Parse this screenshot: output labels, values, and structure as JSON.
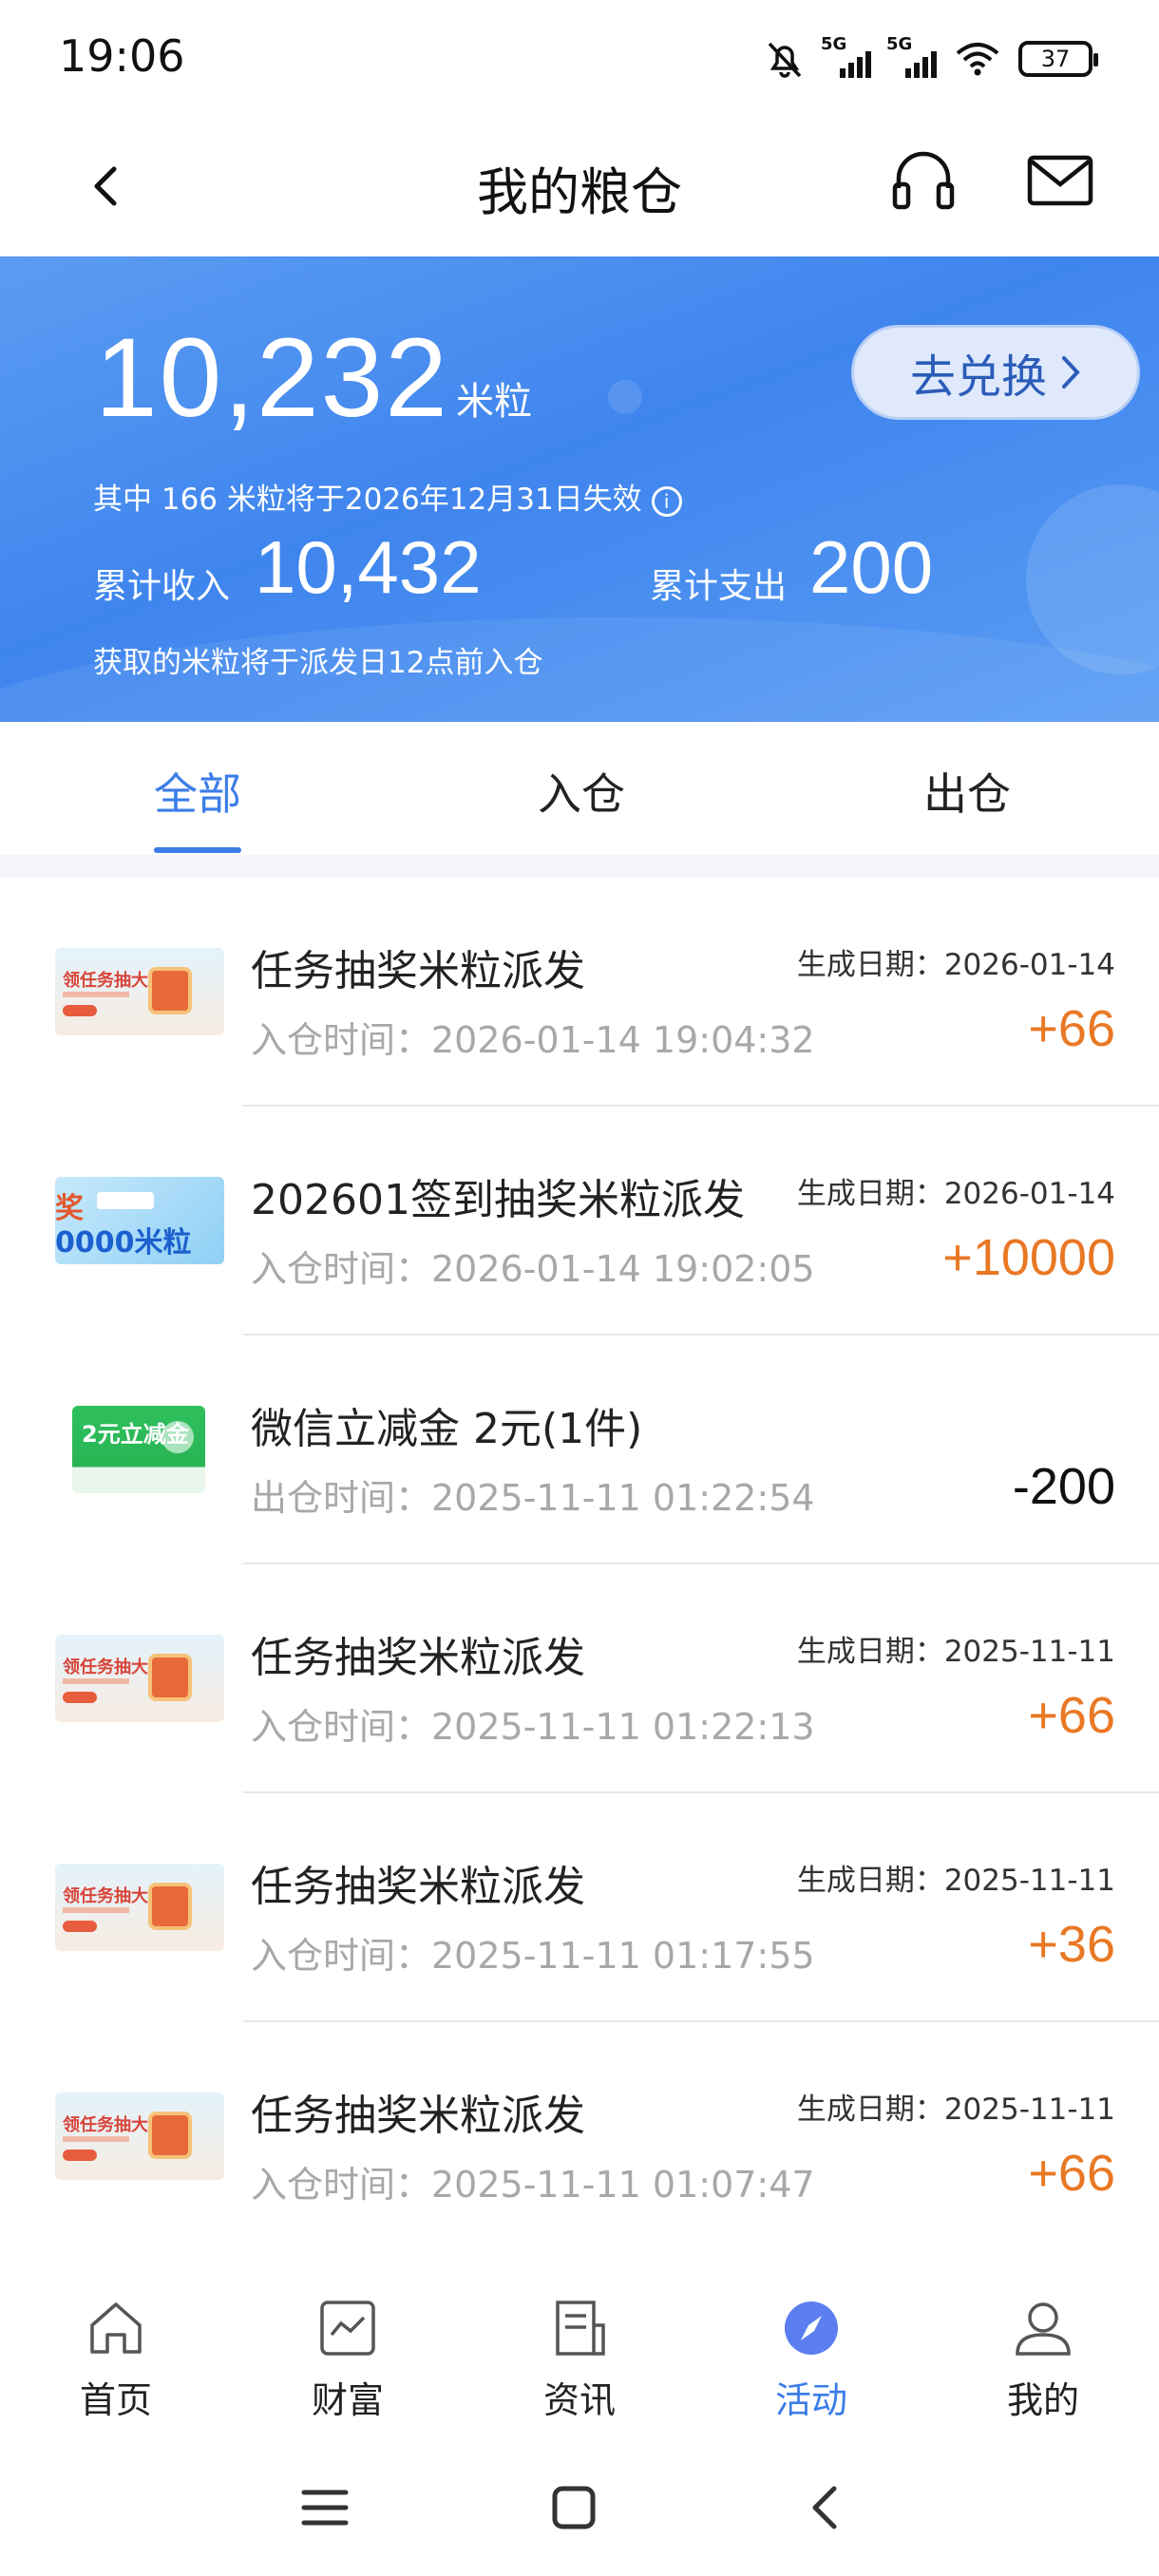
{
  "status_bar": {
    "time": "19:06",
    "network1": "5G",
    "network2": "5G",
    "battery": "37"
  },
  "header": {
    "title": "我的粮仓",
    "back_icon": "chevron-left-icon",
    "service_icon": "headset-icon",
    "message_icon": "mail-icon"
  },
  "banner": {
    "balance": "10,232",
    "unit": "米粒",
    "redeem_label": "去兑换",
    "expire_note": "其中 166 米粒将于2026年12月31日失效",
    "income_label": "累计收入",
    "income_value": "10,432",
    "expense_label": "累计支出",
    "expense_value": "200",
    "arrival_note": "获取的米粒将于派发日12点前入仓",
    "colors": {
      "start": "#5b9cf2",
      "end": "#3f85ee"
    }
  },
  "tabs": [
    {
      "label": "全部",
      "active": true
    },
    {
      "label": "入仓",
      "active": false
    },
    {
      "label": "出仓",
      "active": false
    }
  ],
  "records": [
    {
      "thumb": "task",
      "title": "任务抽奖米粒派发",
      "time": "入仓时间：2026-01-14 19:04:32",
      "date": "生成日期：2026-01-14",
      "amount": "+66",
      "direction": "in"
    },
    {
      "thumb": "sign",
      "title": "202601签到抽奖米粒派发",
      "time": "入仓时间：2026-01-14 19:02:05",
      "date": "生成日期：2026-01-14",
      "amount": "+10000",
      "direction": "in"
    },
    {
      "thumb": "wechat",
      "title": "微信立减金 2元(1件)",
      "time": "出仓时间：2025-11-11 01:22:54",
      "date": "",
      "amount": "-200",
      "direction": "out"
    },
    {
      "thumb": "task",
      "title": "任务抽奖米粒派发",
      "time": "入仓时间：2025-11-11 01:22:13",
      "date": "生成日期：2025-11-11",
      "amount": "+66",
      "direction": "in"
    },
    {
      "thumb": "task",
      "title": "任务抽奖米粒派发",
      "time": "入仓时间：2025-11-11 01:17:55",
      "date": "生成日期：2025-11-11",
      "amount": "+36",
      "direction": "in"
    },
    {
      "thumb": "task",
      "title": "任务抽奖米粒派发",
      "time": "入仓时间：2025-11-11 01:07:47",
      "date": "生成日期：2025-11-11",
      "amount": "+66",
      "direction": "in"
    }
  ],
  "thumb_text": {
    "task": "领任务抽大奖",
    "sign_top": "奖",
    "sign_bottom": "0000米粒",
    "wechat": "2元立减金"
  },
  "bottom_nav": [
    {
      "label": "首页",
      "icon": "home-icon",
      "active": false
    },
    {
      "label": "财富",
      "icon": "chart-icon",
      "active": false
    },
    {
      "label": "资讯",
      "icon": "news-icon",
      "active": false
    },
    {
      "label": "活动",
      "icon": "compass-icon",
      "active": true
    },
    {
      "label": "我的",
      "icon": "user-icon",
      "active": false
    }
  ],
  "accent_color": "#3b7de8",
  "income_color": "#e97824"
}
